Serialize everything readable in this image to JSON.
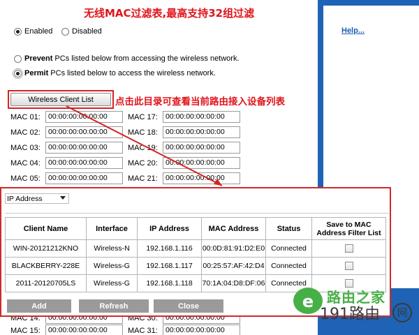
{
  "annotations": {
    "title": "无线MAC过滤表,最高支持32组过滤",
    "wireless_client_note": "点击此目录可查看当前路由接入设备列表"
  },
  "help_link": "Help...",
  "mode": {
    "enabled_label": "Enabled",
    "disabled_label": "Disabled",
    "selected": "Enabled"
  },
  "policy": {
    "prevent_bold": "Prevent",
    "prevent_rest": " PCs listed below from accessing the wireless network.",
    "permit_bold": "Permit",
    "permit_rest": " PCs listed below to access the wireless network.",
    "selected": "Permit"
  },
  "wireless_client_button": "Wireless Client List",
  "mac_left": [
    {
      "label": "MAC 01:",
      "value": "00:00:00:00:00:00"
    },
    {
      "label": "MAC 02:",
      "value": "00:00:00:00:00:00"
    },
    {
      "label": "MAC 03:",
      "value": "00:00:00:00:00:00"
    },
    {
      "label": "MAC 04:",
      "value": "00:00:00:00:00:00"
    },
    {
      "label": "MAC 05:",
      "value": "00:00:00:00:00:00"
    }
  ],
  "mac_right": [
    {
      "label": "MAC 17:",
      "value": "00:00:00:00:00:00"
    },
    {
      "label": "MAC 18:",
      "value": "00:00:00:00:00:00"
    },
    {
      "label": "MAC 19:",
      "value": "00:00:00:00:00:00"
    },
    {
      "label": "MAC 20:",
      "value": "00:00:00:00:00:00"
    },
    {
      "label": "MAC 21:",
      "value": "00:00:00:00:00:00"
    }
  ],
  "mac_bottom": [
    {
      "label": "MAC 14:",
      "value": "00:00:00:00:00:00",
      "label2": "MAC 30:",
      "value2": "00:00:00:00:00:00"
    },
    {
      "label": "MAC 15:",
      "value": "00:00:00:00:00:00",
      "label2": "MAC 31:",
      "value2": "00:00:00:00:00:00"
    }
  ],
  "popup": {
    "filter_select": "IP Address",
    "columns": [
      "Client Name",
      "Interface",
      "IP Address",
      "MAC Address",
      "Status",
      "Save to MAC Address Filter List"
    ],
    "rows": [
      [
        "WIN-20121212KNO",
        "Wireless-N",
        "192.168.1.116",
        "00:0D:81:91:D2:E0",
        "Connected"
      ],
      [
        "BLACKBERRY-228E",
        "Wireless-G",
        "192.168.1.117",
        "00:25:57:AF:42:D4",
        "Connected"
      ],
      [
        "2011-20120705LS",
        "Wireless-G",
        "192.168.1.118",
        "70:1A:04:D8:DF:06",
        "Connected"
      ]
    ],
    "add_button": "Add",
    "refresh_button": "Refresh",
    "close_button": "Close"
  },
  "watermark": {
    "logo_letter": "e",
    "line1": "路由之家",
    "line2": "191路由",
    "badge": "网"
  },
  "colors": {
    "annotation_red": "#e0141b",
    "sidebar_blue": "#1e63b5",
    "button_gray": "#9a9a9a",
    "watermark_green": "#46b047"
  }
}
